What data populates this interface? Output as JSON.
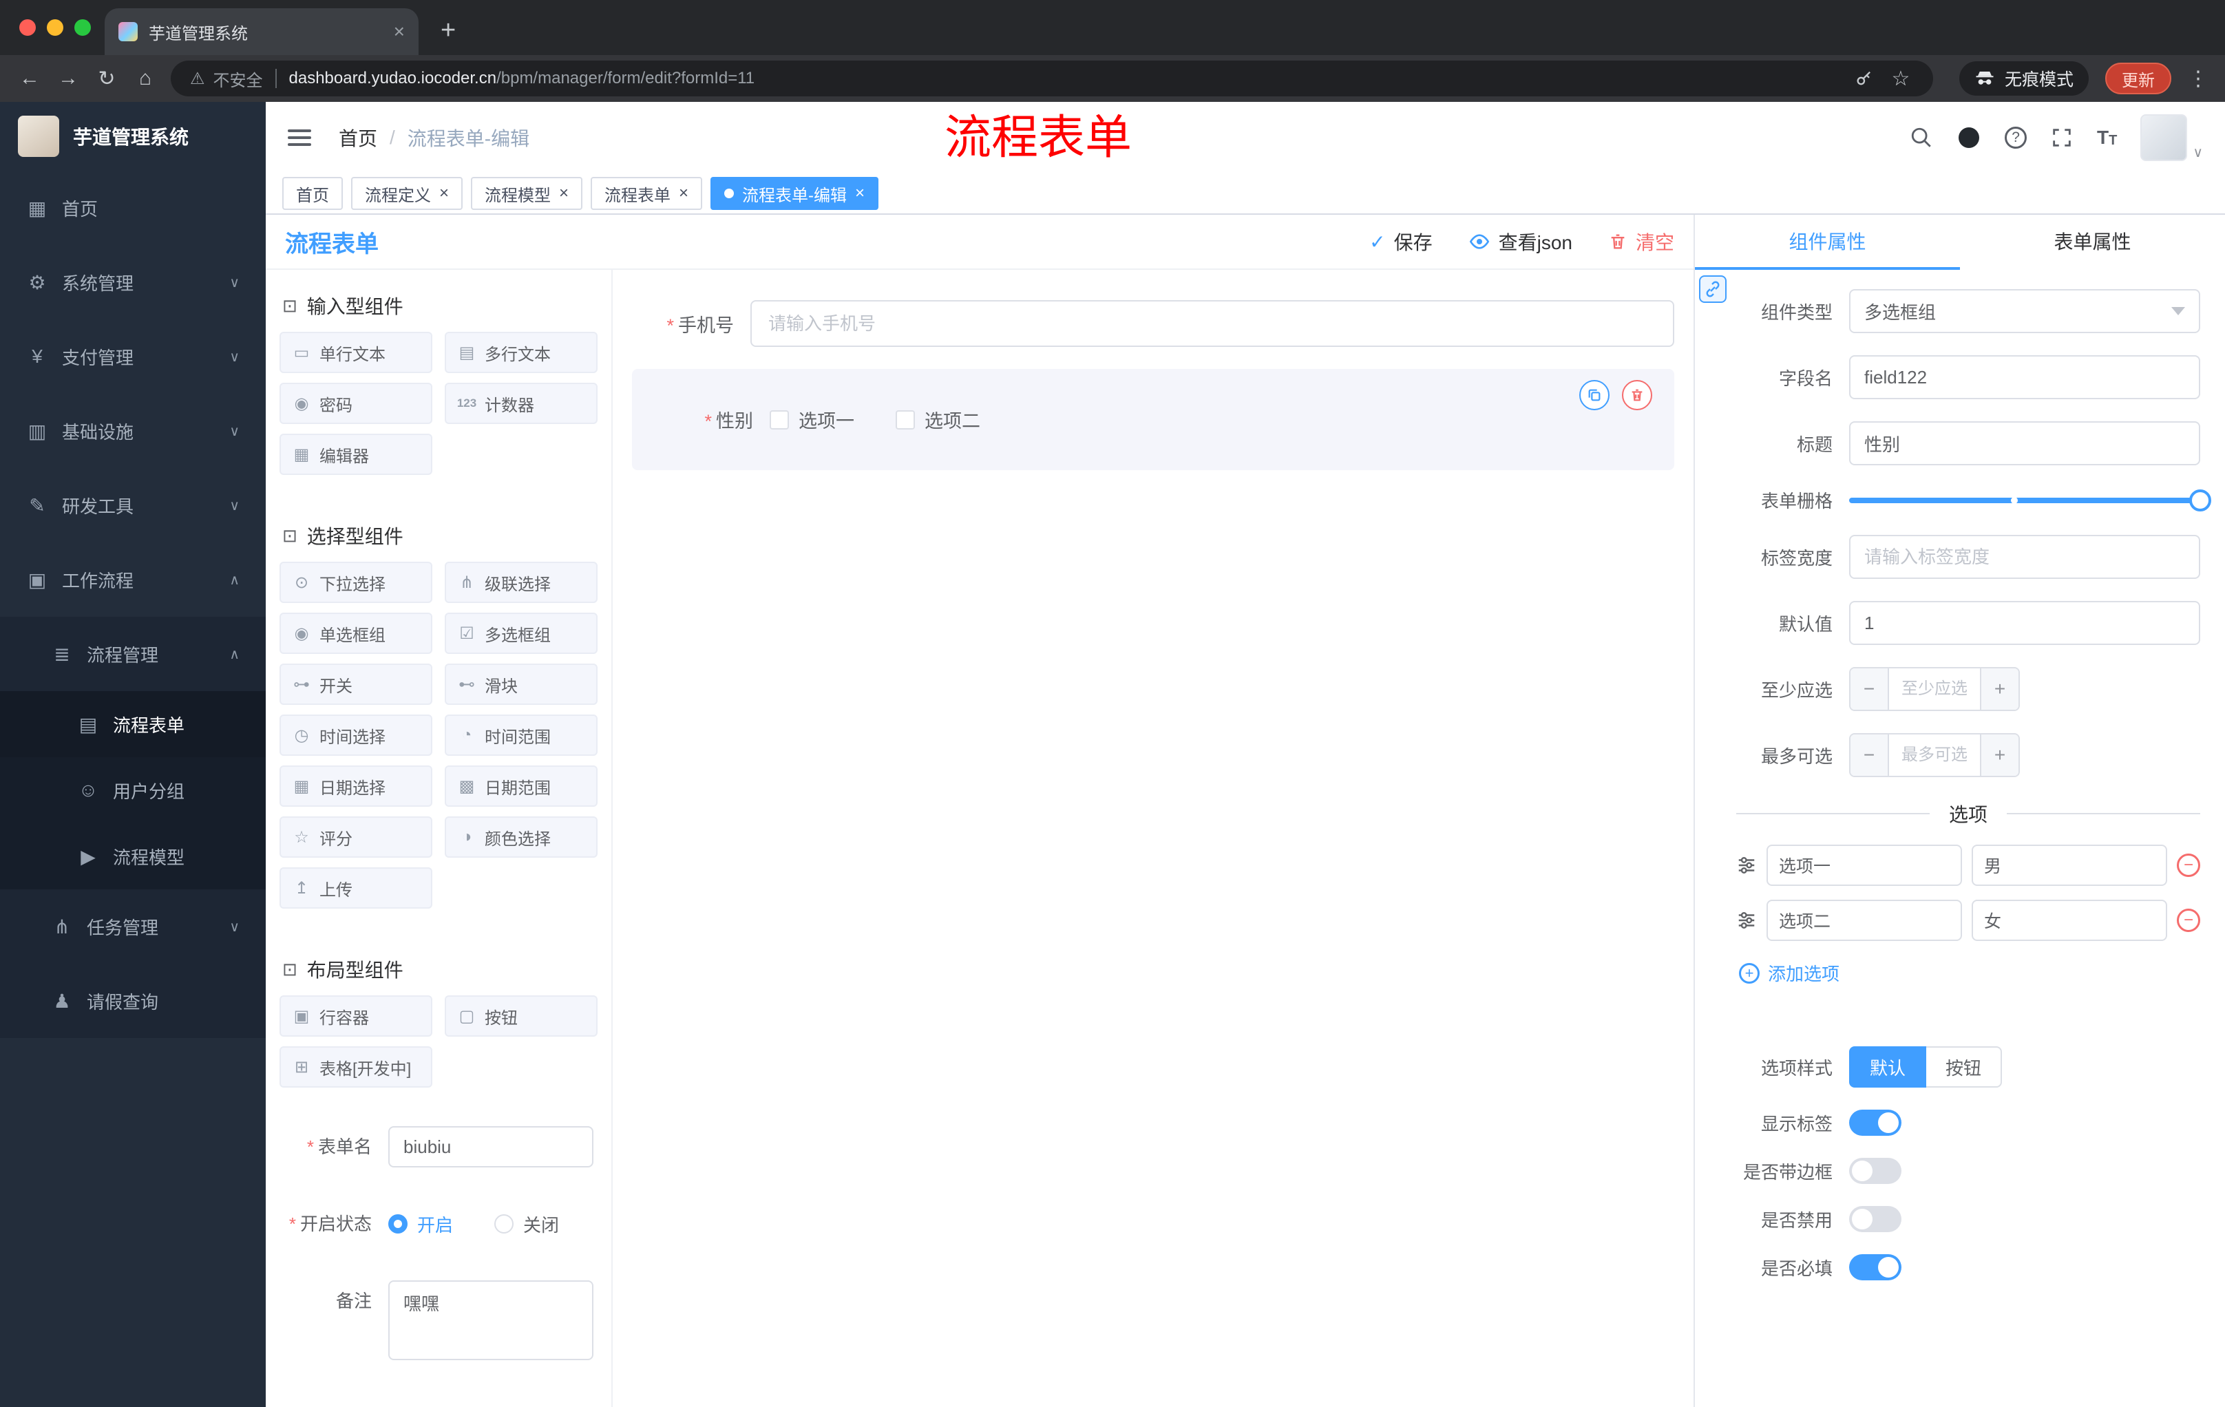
{
  "browser": {
    "tab_title": "芋道管理系统",
    "security": "不安全",
    "url_domain": "dashboard.yudao.iocoder.cn",
    "url_path": "/bpm/manager/form/edit?formId=11",
    "incognito_label": "无痕模式",
    "update_label": "更新"
  },
  "header": {
    "breadcrumb_home": "首页",
    "breadcrumb_current": "流程表单-编辑",
    "overlay_title": "流程表单"
  },
  "page_tabs": [
    {
      "label": "首页"
    },
    {
      "label": "流程定义"
    },
    {
      "label": "流程模型"
    },
    {
      "label": "流程表单"
    },
    {
      "label": "流程表单-编辑"
    }
  ],
  "sidebar": {
    "title": "芋道管理系统",
    "menu": [
      {
        "label": "首页"
      },
      {
        "label": "系统管理"
      },
      {
        "label": "支付管理"
      },
      {
        "label": "基础设施"
      },
      {
        "label": "研发工具"
      },
      {
        "label": "工作流程"
      }
    ],
    "submenu": {
      "process_mgmt": "流程管理",
      "process_form": "流程表单",
      "user_group": "用户分组",
      "process_model": "流程模型",
      "task_mgmt": "任务管理",
      "leave_query": "请假查询"
    }
  },
  "designer": {
    "panel_title": "流程表单",
    "save_label": "保存",
    "view_json_label": "查看json",
    "clear_label": "清空",
    "groups": [
      {
        "title": "输入型组件"
      },
      {
        "title": "选择型组件"
      },
      {
        "title": "布局型组件"
      }
    ],
    "components": {
      "input": "单行文本",
      "textarea": "多行文本",
      "password": "密码",
      "number": "计数器",
      "editor": "编辑器",
      "select": "下拉选择",
      "cascader": "级联选择",
      "radio": "单选框组",
      "checkbox": "多选框组",
      "switch": "开关",
      "slider": "滑块",
      "time": "时间选择",
      "time_range": "时间范围",
      "date": "日期选择",
      "date_range": "日期范围",
      "rate": "评分",
      "color": "颜色选择",
      "upload": "上传",
      "row": "行容器",
      "button": "按钮",
      "table": "表格[开发中]"
    },
    "meta": {
      "form_name_label": "表单名",
      "form_name_value": "biubiu",
      "status_label": "开启状态",
      "status_on": "开启",
      "status_off": "关闭",
      "remark_label": "备注",
      "remark_value": "嘿嘿"
    },
    "canvas": {
      "phone_label": "手机号",
      "phone_placeholder": "请输入手机号",
      "gender_label": "性别",
      "gender_option1": "选项一",
      "gender_option2": "选项二"
    }
  },
  "props": {
    "tab_component": "组件属性",
    "tab_form": "表单属性",
    "component_type_label": "组件类型",
    "component_type_value": "多选框组",
    "field_name_label": "字段名",
    "field_name_value": "field122",
    "title_label": "标题",
    "title_value": "性别",
    "grid_label": "表单栅格",
    "label_width_label": "标签宽度",
    "label_width_placeholder": "请输入标签宽度",
    "default_label": "默认值",
    "default_value": "1",
    "min_label": "至少应选",
    "min_placeholder": "至少应选",
    "max_label": "最多可选",
    "max_placeholder": "最多可选",
    "options_divider": "选项",
    "options": [
      {
        "label": "选项一",
        "value": "男"
      },
      {
        "label": "选项二",
        "value": "女"
      }
    ],
    "add_option_label": "添加选项",
    "option_style_label": "选项样式",
    "style_default": "默认",
    "style_button": "按钮",
    "toggle_show_label": "显示标签",
    "toggle_border": "是否带边框",
    "toggle_disabled": "是否禁用",
    "toggle_required": "是否必填"
  },
  "icons": {
    "back": "←",
    "forward": "→",
    "reload": "↻",
    "home": "⌂",
    "warning": "⚠",
    "star": "☆",
    "kebab": "⋮",
    "help": "?",
    "caret_down": "∨",
    "chevron_down": "∨",
    "chevron_up": "∧",
    "check": "✓",
    "breadcrumb_sep": "/",
    "close": "×",
    "plus_tab": "+",
    "minus": "−",
    "plus": "+",
    "font_big": "T",
    "font_small": "T",
    "menu_home": "▦",
    "menu_system": "⚙",
    "menu_pay": "¥",
    "menu_infra": "▥",
    "menu_dev": "✎",
    "menu_workflow": "▣",
    "menu_process_mgmt": "≣",
    "menu_form": "▤",
    "menu_user_group": "☺",
    "menu_model": "▶",
    "menu_task": "⋔",
    "menu_leave": "♟",
    "group_header": "⊡",
    "comp_input": "▭",
    "comp_textarea": "▤",
    "comp_password": "◉",
    "comp_number": "123",
    "comp_editor": "▦",
    "comp_select": "⊙",
    "comp_cascader": "⋔",
    "comp_radio": "◉",
    "comp_checkbox": "☑",
    "comp_switch": "⊶",
    "comp_slider": "⊷",
    "comp_time": "◷",
    "comp_time_range": "◔",
    "comp_date": "▦",
    "comp_date_range": "▩",
    "comp_rate": "☆",
    "comp_color": "◑",
    "comp_upload": "↥",
    "comp_row": "▣",
    "comp_button": "▢",
    "comp_table": "⊞"
  },
  "colors": {
    "primary": "#409eff",
    "danger": "#f56c6c",
    "annotation_red": "#fe0000",
    "sidebar_bg": "#232d3b"
  }
}
